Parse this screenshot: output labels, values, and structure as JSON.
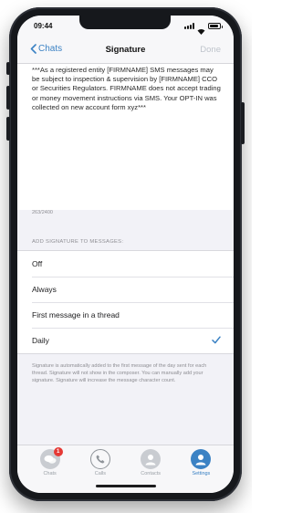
{
  "status_bar": {
    "time": "09:44"
  },
  "nav": {
    "back_label": "Chats",
    "title": "Signature",
    "done_label": "Done"
  },
  "signature": {
    "text": "***As a registered entity [FIRMNAME] SMS messages may be subject to inspection & supervision by [FIRMNAME] CCO or Securities Regulators. FIRMNAME does not accept trading or money movement instructions via SMS. Your OPT-IN was collected on new account form xyz***",
    "char_count": "263/2400"
  },
  "section": {
    "header": "ADD SIGNATURE TO MESSAGES:"
  },
  "options": [
    {
      "label": "Off"
    },
    {
      "label": "Always"
    },
    {
      "label": "First message in a thread"
    },
    {
      "label": "Daily"
    }
  ],
  "footnote": "Signature is automatically added to the first message of the day sent for each thread. Signature will not show in the composer. You can manually add your signature. Signature will increase the message character count.",
  "tabs": [
    {
      "label": "Chats",
      "badge": "1"
    },
    {
      "label": "Calls"
    },
    {
      "label": "Contacts"
    },
    {
      "label": "Settings"
    }
  ],
  "colors": {
    "accent": "#3b82c4",
    "badge": "#e53935"
  }
}
